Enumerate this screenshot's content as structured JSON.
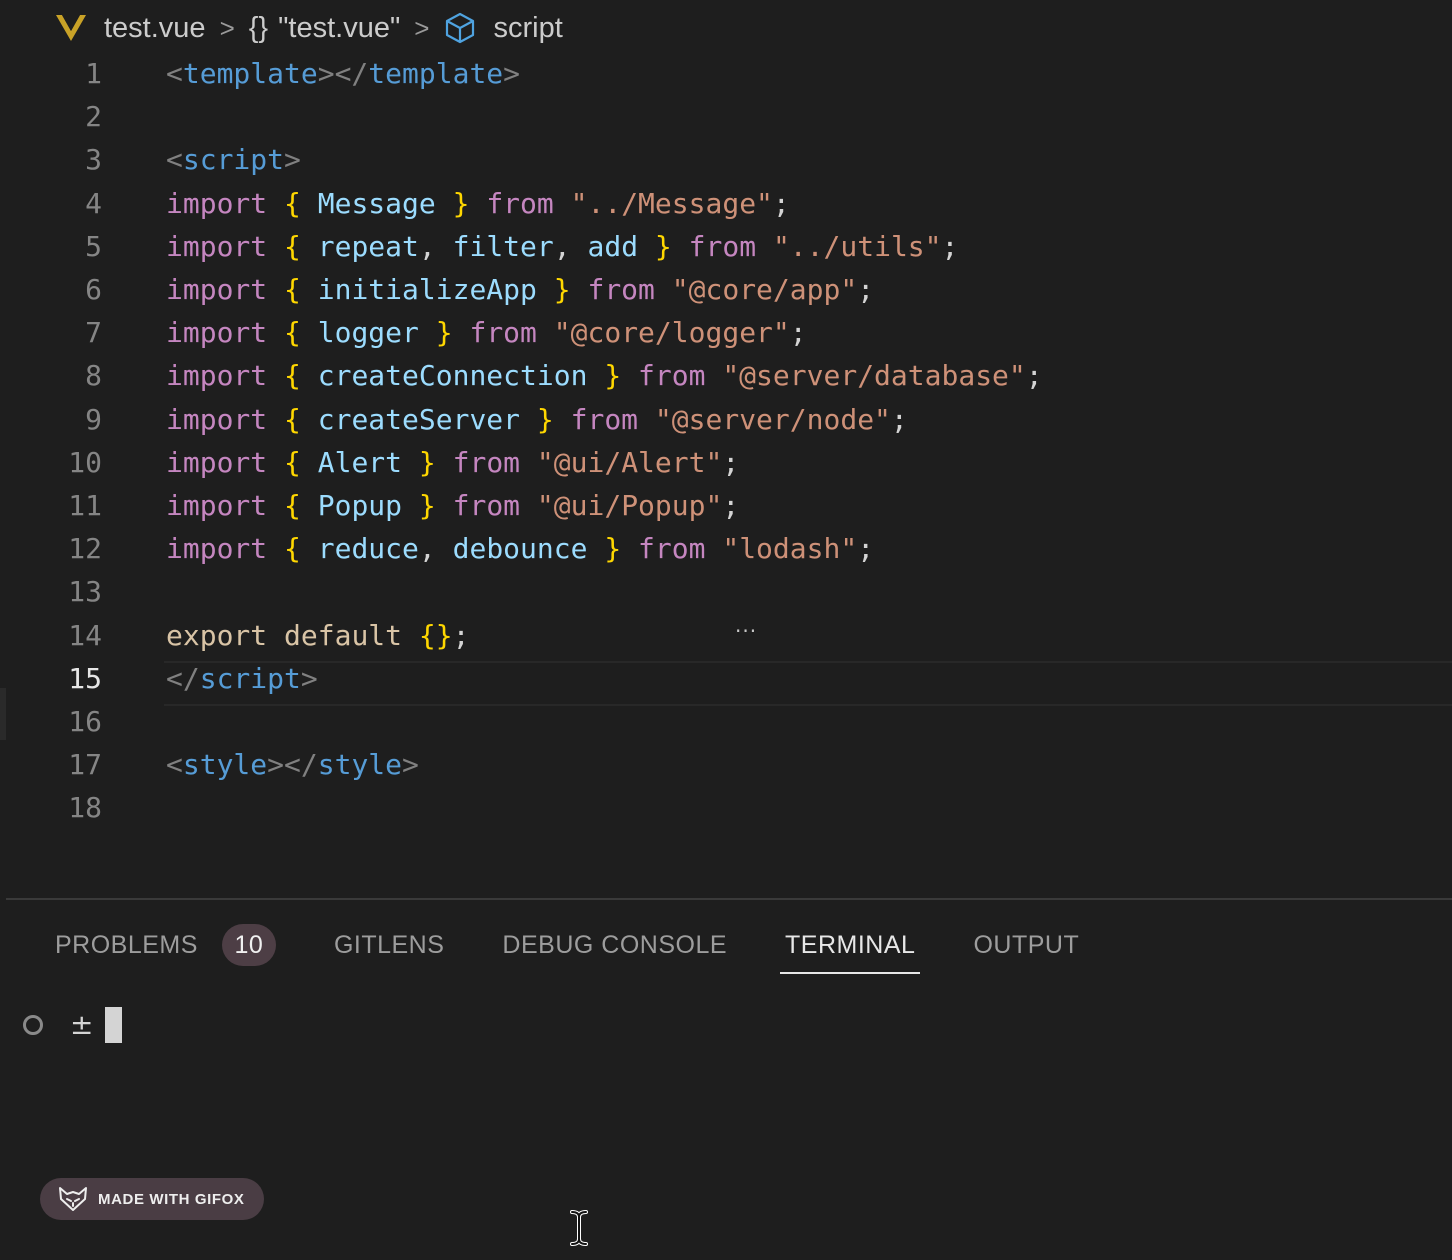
{
  "breadcrumb": {
    "file": "test.vue",
    "braces": "{}",
    "object": "\"test.vue\"",
    "section": "script",
    "separator": ">"
  },
  "editor": {
    "active_line": 15,
    "lines": [
      {
        "n": "1"
      },
      {
        "n": "2"
      },
      {
        "n": "3"
      },
      {
        "n": "4"
      },
      {
        "n": "5"
      },
      {
        "n": "6"
      },
      {
        "n": "7"
      },
      {
        "n": "8"
      },
      {
        "n": "9"
      },
      {
        "n": "10"
      },
      {
        "n": "11"
      },
      {
        "n": "12"
      },
      {
        "n": "13"
      },
      {
        "n": "14"
      },
      {
        "n": "15"
      },
      {
        "n": "16"
      },
      {
        "n": "17"
      },
      {
        "n": "18"
      }
    ],
    "code": {
      "template_tag": "template",
      "script_tag": "script",
      "style_tag": "style",
      "imports": [
        {
          "names": [
            "Message"
          ],
          "source": "\"../Message\""
        },
        {
          "names": [
            "repeat",
            "filter",
            "add"
          ],
          "source": "\"../utils\""
        },
        {
          "names": [
            "initializeApp"
          ],
          "source": "\"@core/app\""
        },
        {
          "names": [
            "logger"
          ],
          "source": "\"@core/logger\""
        },
        {
          "names": [
            "createConnection"
          ],
          "source": "\"@server/database\""
        },
        {
          "names": [
            "createServer"
          ],
          "source": "\"@server/node\""
        },
        {
          "names": [
            "Alert"
          ],
          "source": "\"@ui/Alert\""
        },
        {
          "names": [
            "Popup"
          ],
          "source": "\"@ui/Popup\""
        },
        {
          "names": [
            "reduce",
            "debounce"
          ],
          "source": "\"lodash\""
        }
      ],
      "kw_import": "import",
      "kw_from": "from",
      "kw_export": "export",
      "kw_default": "default"
    },
    "hint_dots": "..."
  },
  "panel": {
    "tabs": [
      {
        "label": "PROBLEMS",
        "badge": "10",
        "active": false
      },
      {
        "label": "GITLENS",
        "active": false
      },
      {
        "label": "DEBUG CONSOLE",
        "active": false
      },
      {
        "label": "TERMINAL",
        "active": true
      },
      {
        "label": "OUTPUT",
        "active": false
      }
    ]
  },
  "terminal": {
    "prompt": "±"
  },
  "watermark": {
    "label": "MADE WITH GIFOX"
  },
  "colors": {
    "background": "#1e1e1e",
    "keyword": "#c586c0",
    "identifier": "#9cdcfe",
    "string": "#ce9178",
    "brace": "#ffd700",
    "tag": "#569cd6"
  }
}
